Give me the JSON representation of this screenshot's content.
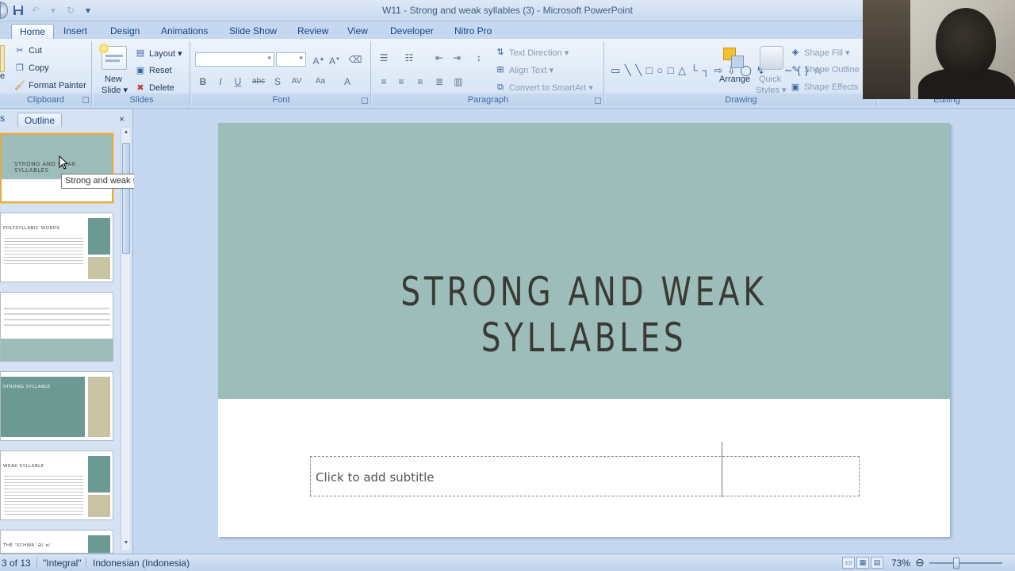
{
  "window": {
    "title": "W11 - Strong and weak syllables (3) - Microsoft PowerPoint"
  },
  "qat": {
    "icons": [
      "save-icon",
      "undo-icon",
      "redo-icon",
      "customize-icon"
    ]
  },
  "tabs": [
    {
      "label": "Home",
      "active": true
    },
    {
      "label": "Insert"
    },
    {
      "label": "Design"
    },
    {
      "label": "Animations"
    },
    {
      "label": "Slide Show"
    },
    {
      "label": "Review"
    },
    {
      "label": "View"
    },
    {
      "label": "Developer"
    },
    {
      "label": "Nitro Pro"
    }
  ],
  "ribbon": {
    "clipboard": {
      "label": "Clipboard",
      "cut": "Cut",
      "copy": "Copy",
      "format_painter": "Format Painter",
      "paste_partial": "e"
    },
    "slides": {
      "label": "Slides",
      "new_slide_1": "New",
      "new_slide_2": "Slide ▾",
      "layout": "Layout ▾",
      "reset": "Reset",
      "delete": "Delete"
    },
    "font": {
      "label": "Font"
    },
    "paragraph": {
      "label": "Paragraph",
      "text_direction": "Text Direction ▾",
      "align_text": "Align Text ▾",
      "convert_smartart": "Convert to SmartArt ▾"
    },
    "drawing": {
      "label": "Drawing",
      "arrange": "Arrange",
      "quick_styles_1": "Quick",
      "quick_styles_2": "Styles ▾",
      "shape_fill": "Shape Fill ▾",
      "shape_outline": "Shape Outline",
      "shape_effects": "Shape Effects"
    },
    "editing": {
      "label": "Editing"
    }
  },
  "slides_pane": {
    "tab_slides": "s",
    "tab_outline": "Outline",
    "close": "×",
    "thumbnails": [
      {
        "title": "STRONG AND WEAK SYLLABLES",
        "selected": true
      },
      {
        "title": "POLYSYLLABIC WORDS"
      },
      {
        "title": ""
      },
      {
        "title": "STRONG SYLLABLE"
      },
      {
        "title": "WEAK SYLLABLE"
      },
      {
        "title": "THE 'SCHWA' Ə/ ə/"
      }
    ],
    "tooltip": "Strong and weak syllables"
  },
  "slide": {
    "title": "STRONG AND WEAK SYLLABLES",
    "subtitle_placeholder": "Click to add subtitle",
    "band_color": "#9dbdbb"
  },
  "status": {
    "slide_counter": "3 of 13",
    "theme": "\"Integral\"",
    "language": "Indonesian (Indonesia)",
    "zoom": "73%"
  }
}
